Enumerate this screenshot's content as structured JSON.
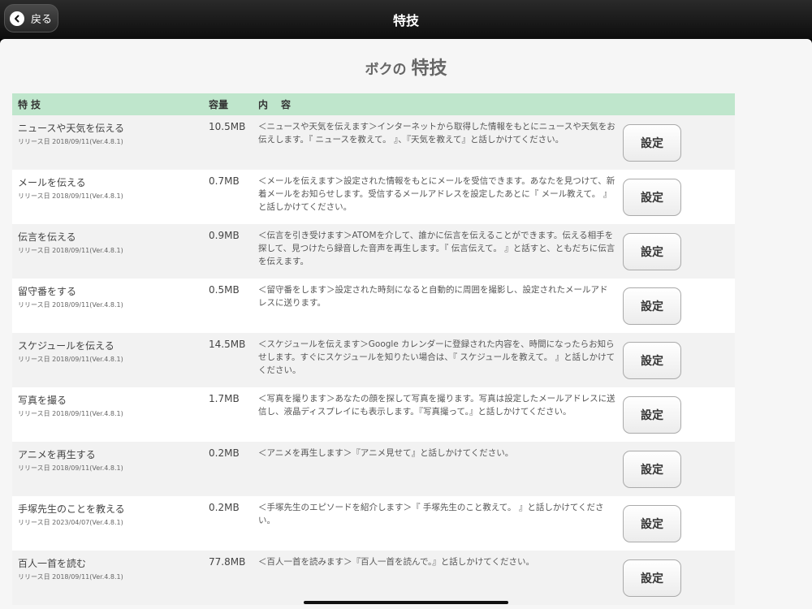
{
  "navbar": {
    "back_label": "戻る",
    "title": "特技"
  },
  "heading": {
    "pre": "ボクの",
    "main": "特技"
  },
  "table": {
    "headers": {
      "skill": "特技",
      "size": "容量",
      "content": "内　容"
    },
    "button_label": "設定",
    "rows": [
      {
        "name": "ニュースや天気を伝える",
        "release": "リリース日 2018/09/11(Ver.4.8.1)",
        "size": "10.5MB",
        "desc": "＜ニュースや天気を伝えます＞インターネットから取得した情報をもとにニュースや天気をお伝えします。『 ニュースを教えて。 』、『天気を教えて』と話しかけてください。"
      },
      {
        "name": "メールを伝える",
        "release": "リリース日 2018/09/11(Ver.4.8.1)",
        "size": "0.7MB",
        "desc": "＜メールを伝えます＞設定された情報をもとにメールを受信できます。あなたを見つけて、新着メールをお知らせします。受信するメールアドレスを設定したあとに『 メール教えて。 』と話しかけてください。"
      },
      {
        "name": "伝言を伝える",
        "release": "リリース日 2018/09/11(Ver.4.8.1)",
        "size": "0.9MB",
        "desc": "＜伝言を引き受けます＞ATOMを介して、誰かに伝言を伝えることができます。伝える相手を探して、見つけたら録音した音声を再生します。『 伝言伝えて。 』と話すと、ともだちに伝言を伝えます。"
      },
      {
        "name": "留守番をする",
        "release": "リリース日 2018/09/11(Ver.4.8.1)",
        "size": "0.5MB",
        "desc": "＜留守番をします＞設定された時刻になると自動的に周囲を撮影し、設定されたメールアドレスに送ります。"
      },
      {
        "name": "スケジュールを伝える",
        "release": "リリース日 2018/09/11(Ver.4.8.1)",
        "size": "14.5MB",
        "desc": "＜スケジュールを伝えます＞Google カレンダーに登録された内容を、時間になったらお知らせします。すぐにスケジュールを知りたい場合は、『 スケジュールを教えて。 』と話しかけてください。"
      },
      {
        "name": "写真を撮る",
        "release": "リリース日 2018/09/11(Ver.4.8.1)",
        "size": "1.7MB",
        "desc": "＜写真を撮ります＞あなたの顔を探して写真を撮ります。写真は設定したメールアドレスに送信し、液晶ディスプレイにも表示します。『写真撮って。』と話しかけてください。"
      },
      {
        "name": "アニメを再生する",
        "release": "リリース日 2018/09/11(Ver.4.8.1)",
        "size": "0.2MB",
        "desc": "＜アニメを再生します＞『アニメ見せて』と話しかけてください。"
      },
      {
        "name": "手塚先生のことを教える",
        "release": "リリース日 2023/04/07(Ver.4.8.1)",
        "size": "0.2MB",
        "desc": "＜手塚先生のエピソードを紹介します＞『 手塚先生のこと教えて。 』と話しかけてください。"
      },
      {
        "name": "百人一首を読む",
        "release": "リリース日 2018/09/11(Ver.4.8.1)",
        "size": "77.8MB",
        "desc": "＜百人一首を読みます＞『百人一首を読んで。』と話しかけてください。"
      }
    ]
  }
}
